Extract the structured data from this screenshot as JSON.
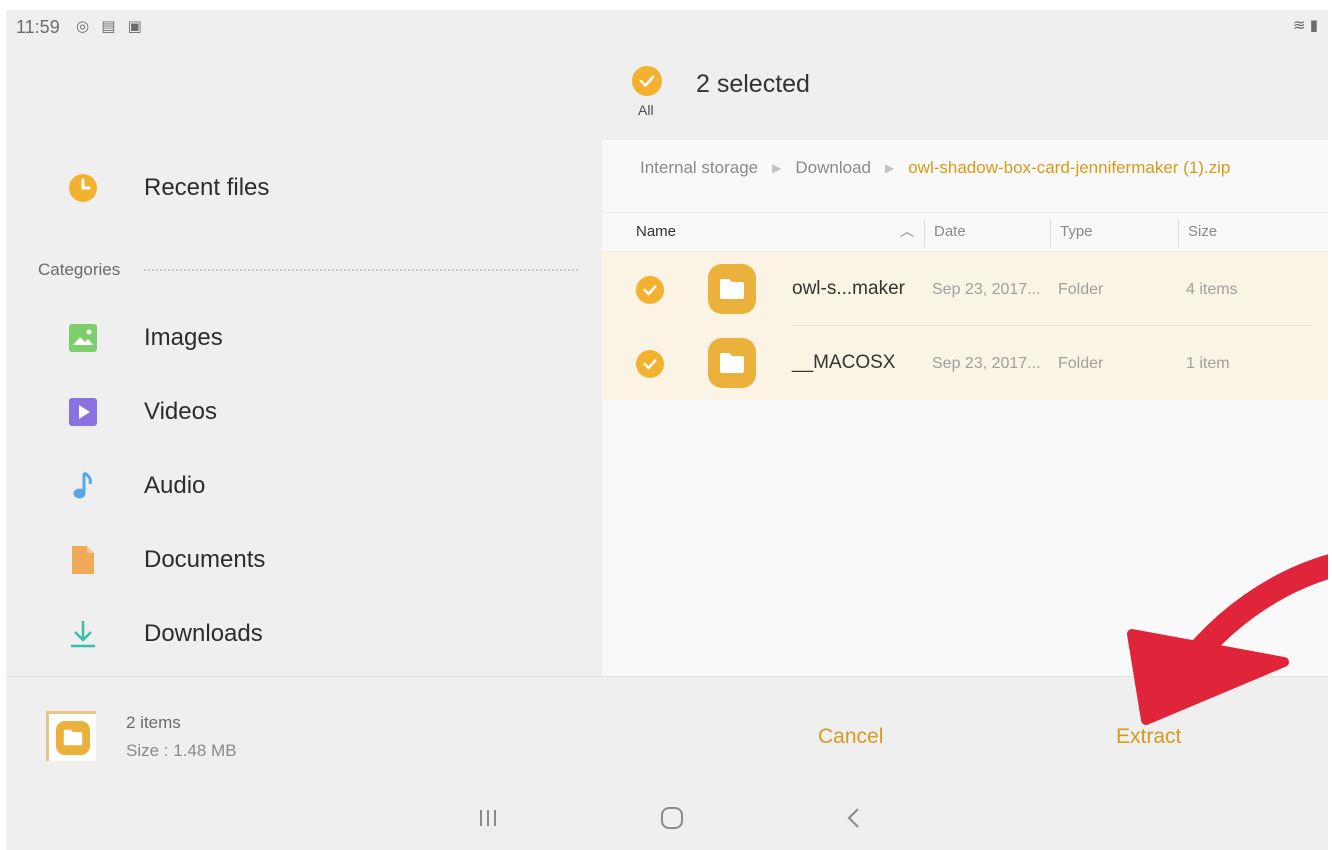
{
  "status_bar": {
    "time": "11:59",
    "left_icons": "◎ ▤ ▣",
    "right_icons": "≋ ▮"
  },
  "sidebar": {
    "recent": {
      "label": "Recent files",
      "icon": "clock-icon",
      "color": "#f2b12f"
    },
    "categories_label": "Categories",
    "items": [
      {
        "label": "Images",
        "icon": "image-icon",
        "color": "#7ccf6b"
      },
      {
        "label": "Videos",
        "icon": "video-icon",
        "color": "#8a72e0"
      },
      {
        "label": "Audio",
        "icon": "music-note-icon",
        "color": "#58a8e8"
      },
      {
        "label": "Documents",
        "icon": "document-icon",
        "color": "#f1a95a"
      },
      {
        "label": "Downloads",
        "icon": "download-icon",
        "color": "#36bfae"
      }
    ]
  },
  "selection": {
    "all_label": "All",
    "title": "2 selected"
  },
  "breadcrumb": [
    "Internal storage",
    "Download",
    "owl-shadow-box-card-jennifermaker (1).zip"
  ],
  "columns": {
    "name": "Name",
    "date": "Date",
    "type": "Type",
    "size": "Size"
  },
  "files": [
    {
      "name": "owl-s...maker",
      "date": "Sep 23, 2017...",
      "type": "Folder",
      "size": "4 items",
      "selected": true
    },
    {
      "name": "__MACOSX",
      "date": "Sep 23, 2017...",
      "type": "Folder",
      "size": "1 item",
      "selected": true
    }
  ],
  "footer": {
    "count": "2 items",
    "size": "Size : 1.48 MB",
    "cancel_label": "Cancel",
    "extract_label": "Extract"
  },
  "colors": {
    "accent": "#f2b12f",
    "action": "#d59a1f",
    "annotation_arrow": "#e0253b"
  }
}
